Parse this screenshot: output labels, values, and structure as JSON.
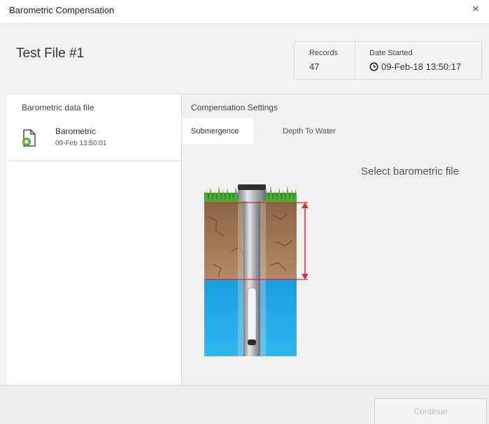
{
  "dialog": {
    "title": "Barometric Compensation",
    "close_glyph": "×"
  },
  "file": {
    "title": "Test File #1"
  },
  "stats": {
    "records_label": "Records",
    "records_value": "47",
    "date_label": "Date Started",
    "date_value": "09-Feb-18 13:50:17",
    "date_icon": "clock-icon"
  },
  "barometric_panel": {
    "heading": "Barometric data file",
    "item": {
      "name": "Barometric",
      "date": "09-Feb 13:50:01",
      "icon": "file-icon"
    }
  },
  "compensation": {
    "heading": "Compensation Settings",
    "tabs": [
      {
        "label": "Submergence",
        "active": true
      },
      {
        "label": "Depth To Water",
        "active": false
      }
    ],
    "placeholder": "Select barometric file"
  },
  "footer": {
    "continue_label": "Continue",
    "continue_enabled": false
  },
  "colors": {
    "accent_green": "#4caf30",
    "water_blue": "#1fa9e6",
    "soil_brown": "#a87d58",
    "marker_red": "#e12a2a"
  }
}
